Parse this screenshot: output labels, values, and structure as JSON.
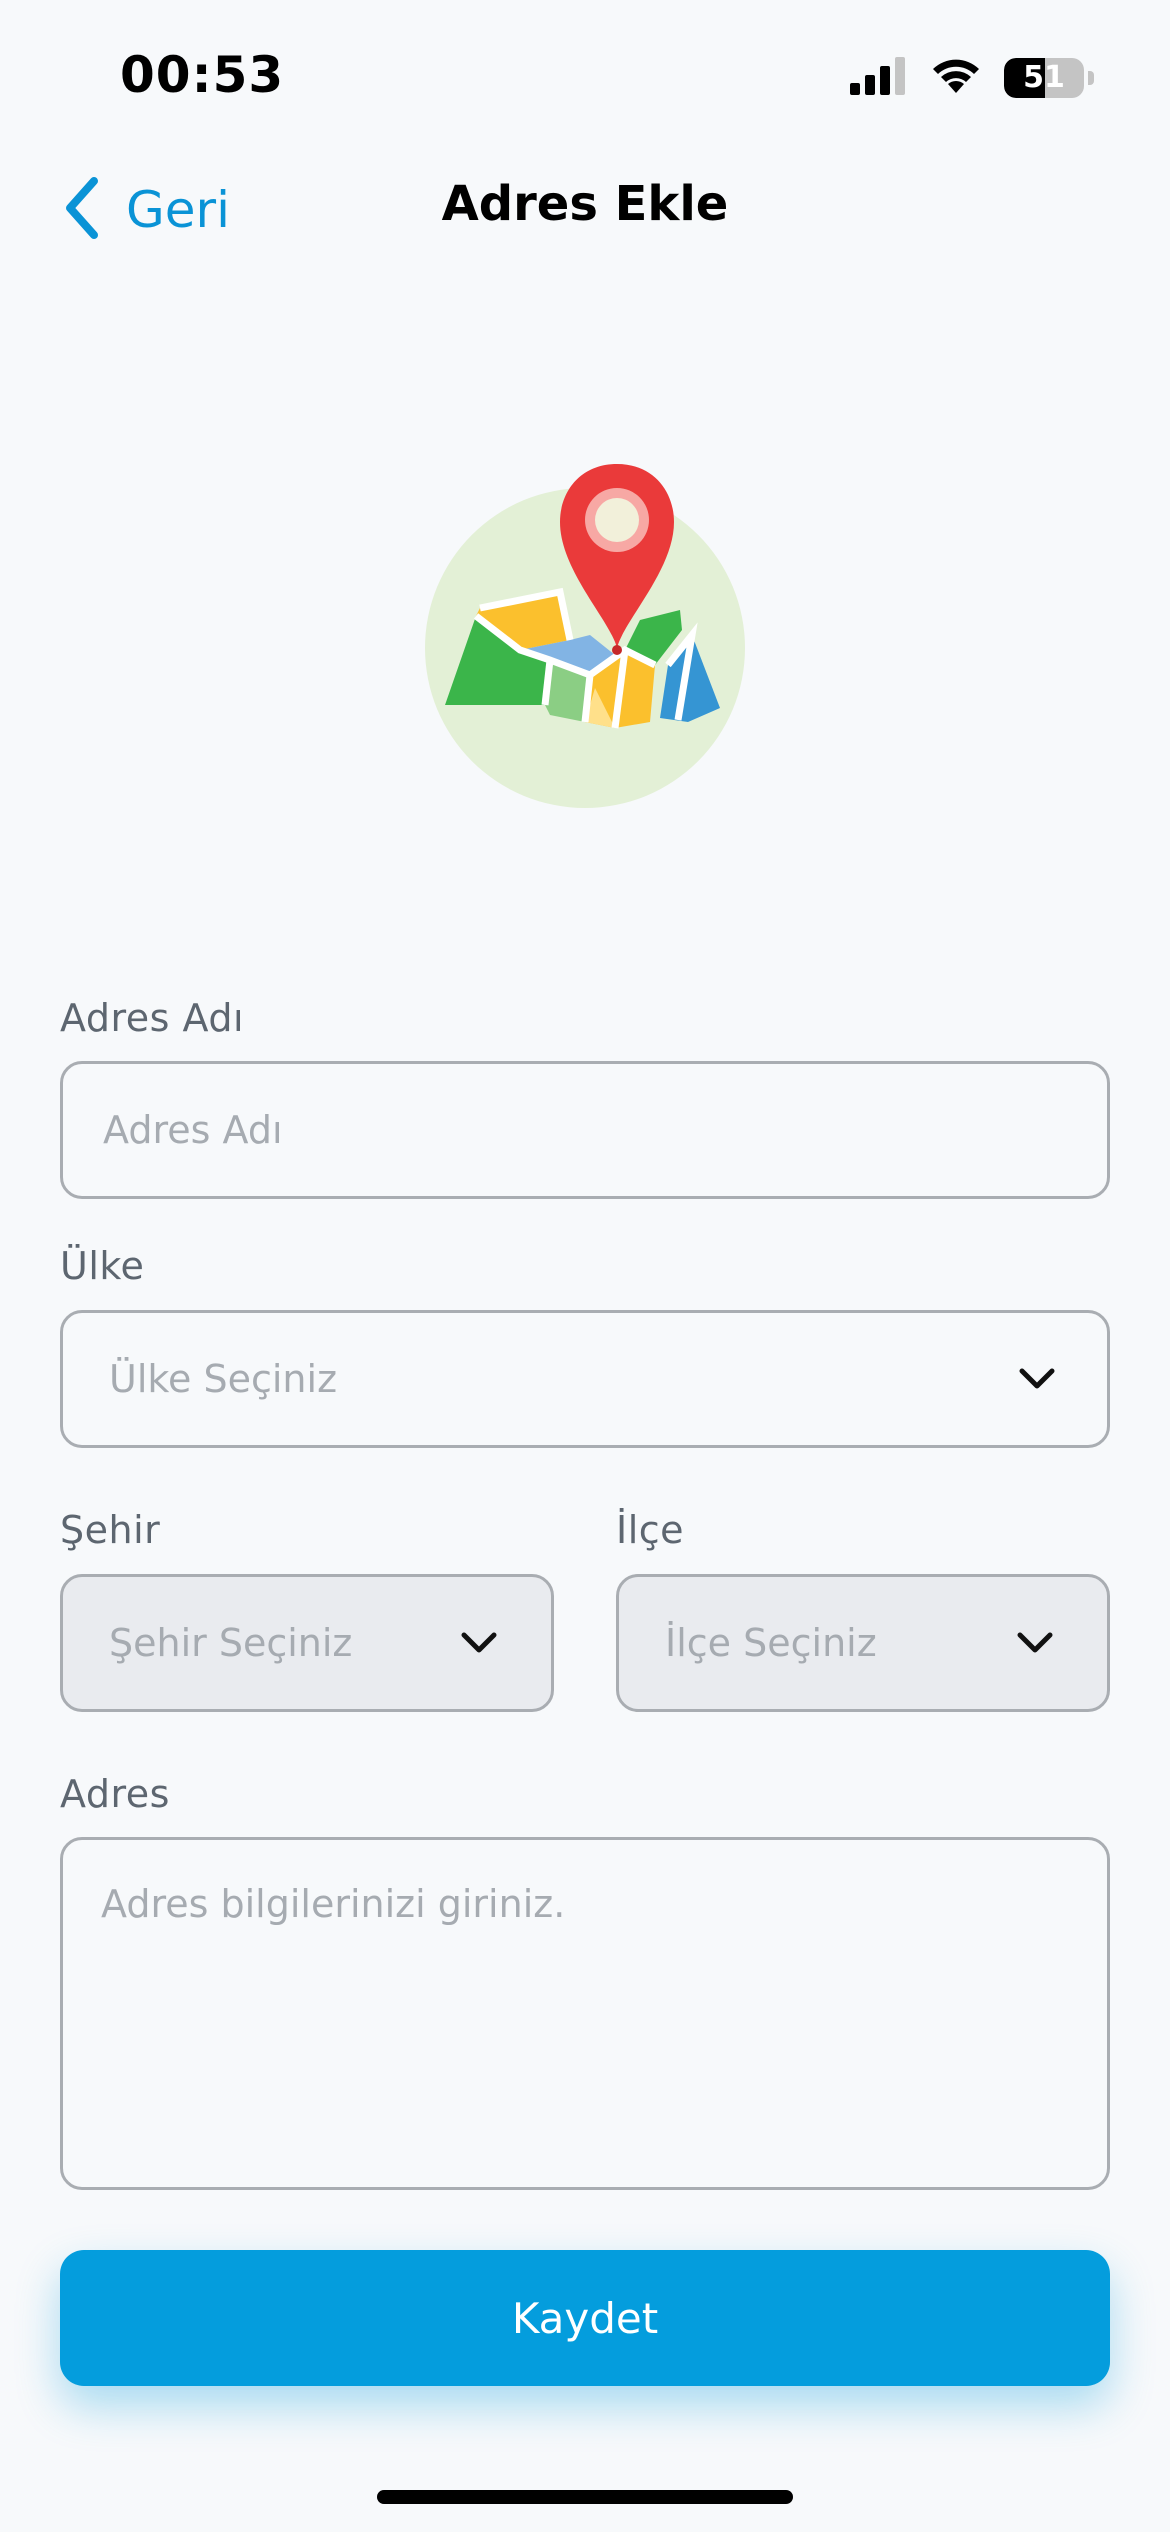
{
  "status_bar": {
    "time": "00:53",
    "battery_level": "51",
    "battery_fraction": 0.51,
    "icons": [
      "cellular-signal-icon",
      "wifi-icon",
      "battery-icon"
    ]
  },
  "nav": {
    "back_label": "Geri",
    "title": "Adres Ekle"
  },
  "illustration": {
    "icon": "map-pin-icon"
  },
  "form": {
    "address_name": {
      "label": "Adres Adı",
      "placeholder": "Adres Adı",
      "value": ""
    },
    "country": {
      "label": "Ülke",
      "placeholder": "Ülke Seçiniz"
    },
    "city": {
      "label": "Şehir",
      "placeholder": "Şehir Seçiniz"
    },
    "district": {
      "label": "İlçe",
      "placeholder": "İlçe Seçiniz"
    },
    "address": {
      "label": "Adres",
      "placeholder": "Adres bilgilerinizi giriniz.",
      "value": ""
    },
    "save_label": "Kaydet"
  },
  "colors": {
    "accent": "#049ddd",
    "link": "#0a93d6",
    "background": "#f7f9fb",
    "disabled_field": "#e9ebef"
  }
}
